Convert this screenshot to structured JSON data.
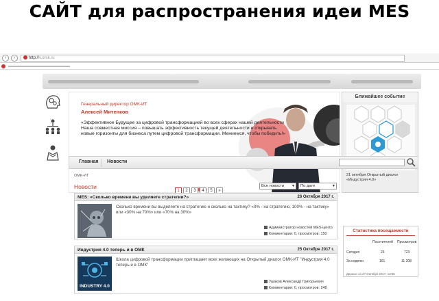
{
  "slide": {
    "title": "САЙТ для распространения идеи MES"
  },
  "browser": {
    "url_prefix": "http://",
    "url_rest": "v.omk.ru"
  },
  "banner": {
    "role": "Генеральный директор ОМК-ИТ",
    "name": "Алексей Митенков",
    "quote": "«Эффективное Будущее за цифровой трансформацией во всех сферах нашей деятельности Наша совместная миссия – повышать эффективность текущей деятельности и открывать новые горизонты для бизнеса путем цифровой трансформации. Мениемся, чтобы победить!»"
  },
  "event": {
    "heading": "Ближайшее событие",
    "text": "21 октября Открытый диалог «Индустрия 4.0»"
  },
  "menu": {
    "items": [
      "Главная",
      "Новости"
    ]
  },
  "content": {
    "breadcrumb": "ОМК-ИТ",
    "news_title": "Новости",
    "pages": [
      "1",
      "2",
      "3",
      "4",
      "5",
      "»"
    ],
    "filter_select": "Все новости",
    "sort_select": "По дате"
  },
  "news": [
    {
      "title": "MES: «Сколько времени вы уделяете стратегии?»",
      "date": "26 Октября 2017 г.",
      "text": "Сколько времени вы выделяете на стратегию и сколько на тактику? «0% - на стратегию, 100% - на тактику» или «30% на 70%» или «70% на 30%»",
      "author": "Администратор новостей MES-центр",
      "comments": "Комментарии: 0, просмотров: 150"
    },
    {
      "title": "Индустрия 4.0 теперь и в ОМК",
      "date": "25 Октября 2017 г.",
      "text": "Школа цифровой трансформации приглашает всех желающих на Открытый диалог ОМК-ИТ \"Индустрия 4.0 теперь и в ОМК\"",
      "image_label": "INDUSTRY 4.0",
      "author": "Ушаков Александр Григорьевич",
      "comments": "Комментарии: 0, просмотров: 248"
    }
  ],
  "stats": {
    "heading": "Статистика посещаемости",
    "col1": "Посетителей",
    "col2": "Просмотров",
    "row1_label": "Сегодня",
    "row1_v1": "23",
    "row1_v2": "723",
    "row2_label": "За неделю",
    "row2_v1": "161",
    "row2_v2": "11 208",
    "note": "Данные на 27 Октября 2017, 13:55"
  },
  "colors": {
    "accent": "#c0392b",
    "menu_bg": "#ececec"
  }
}
